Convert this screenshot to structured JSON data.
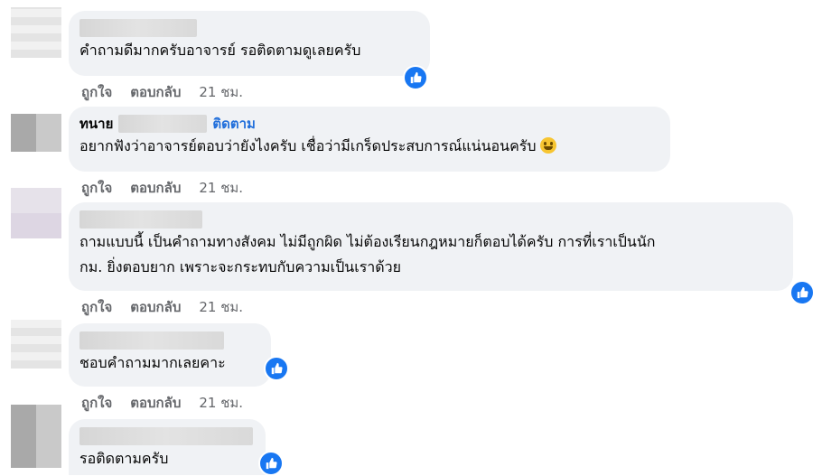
{
  "comments": [
    {
      "author": "",
      "follow": "",
      "text": "คำถามดีมากครับอาจารย์ รอติดตามดูเลยครับ",
      "actions": {
        "like": "ถูกใจ",
        "reply": "ตอบกลับ",
        "time": "21 ชม."
      },
      "reaction": "like-icon"
    },
    {
      "author": "ทนาย",
      "follow": "ติดตาม",
      "text": "อยากฟังว่าอาจารย์ตอบว่ายังไงครับ เชื่อว่ามีเกร็ดประสบการณ์แน่นอนครับ",
      "emoji": "grinning-face-icon",
      "actions": {
        "like": "ถูกใจ",
        "reply": "ตอบกลับ",
        "time": "21 ชม."
      }
    },
    {
      "author": "",
      "text": "ถามแบบนี้ เป็นคำถามทางสังคม ไม่มีถูกผิด ไม่ต้องเรียนกฎหมายก็ตอบได้ครับ การที่เราเป็นนัก\nกม. ยิ่งตอบยาก เพราะจะกระทบกับความเป็นเราด้วย",
      "actions": {
        "like": "ถูกใจ",
        "reply": "ตอบกลับ",
        "time": "21 ชม."
      },
      "reaction": "like-icon"
    },
    {
      "author": "",
      "text": "ชอบคำถามมากเลยคาะ",
      "actions": {
        "like": "ถูกใจ",
        "reply": "ตอบกลับ",
        "time": "21 ชม."
      },
      "reaction": "like-icon"
    },
    {
      "author": "",
      "text": "รอติดตามครับ",
      "reaction": "like-icon"
    }
  ],
  "colors": {
    "bubble": "#f0f2f5",
    "link": "#216fdb",
    "meta": "#65676b",
    "like": "#1877f2"
  }
}
